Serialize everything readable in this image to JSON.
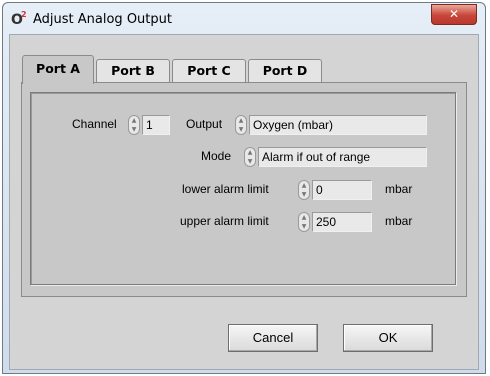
{
  "window": {
    "title": "Adjust Analog Output",
    "icon": "o2-app-icon",
    "close_label": "✕"
  },
  "tabs": [
    {
      "label": "Port A",
      "active": true
    },
    {
      "label": "Port B",
      "active": false
    },
    {
      "label": "Port C",
      "active": false
    },
    {
      "label": "Port D",
      "active": false
    }
  ],
  "form": {
    "channel_label": "Channel",
    "channel_value": "1",
    "output_label": "Output",
    "output_value": "Oxygen (mbar)",
    "mode_label": "Mode",
    "mode_value": "Alarm if out of range",
    "lower_label": "lower alarm limit",
    "lower_value": "0",
    "lower_unit": "mbar",
    "upper_label": "upper alarm limit",
    "upper_value": "250",
    "upper_unit": "mbar"
  },
  "buttons": {
    "cancel": "Cancel",
    "ok": "OK"
  },
  "colors": {
    "close_button": "#c8453a",
    "panel": "#c8c8c8"
  }
}
